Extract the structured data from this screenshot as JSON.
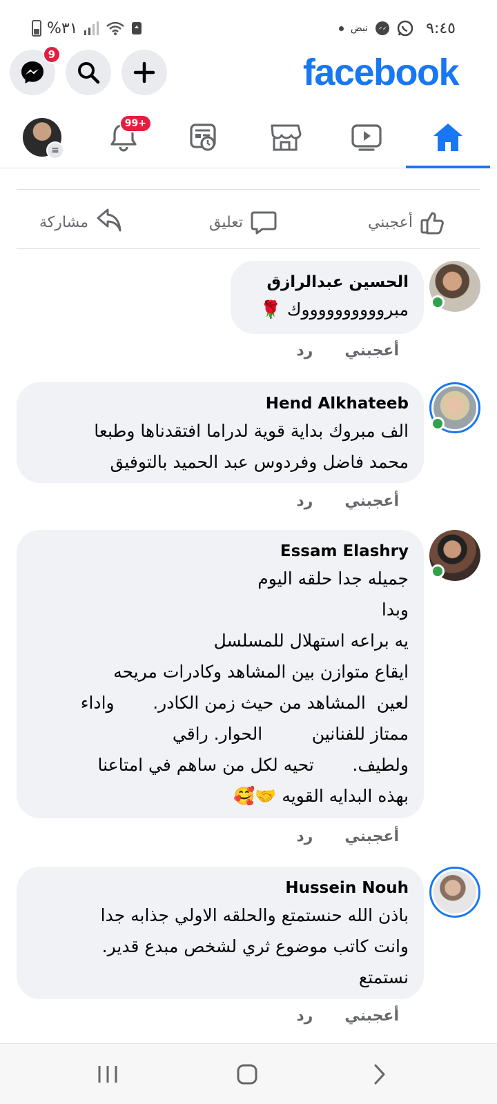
{
  "status_bar": {
    "time": "٩:٤٥",
    "pulse_label": "نبض",
    "battery": "%٣١"
  },
  "header": {
    "logo": "facebook",
    "messenger_badge": "9",
    "accent_color": "#1877f2"
  },
  "tabs": [
    {
      "name": "home",
      "icon": "home-icon",
      "active": true
    },
    {
      "name": "watch",
      "icon": "video-icon"
    },
    {
      "name": "marketplace",
      "icon": "store-icon"
    },
    {
      "name": "memories",
      "icon": "news-clock-icon"
    },
    {
      "name": "notifications",
      "icon": "bell-icon",
      "badge": "99+"
    },
    {
      "name": "menu",
      "icon": "profile-menu-icon"
    }
  ],
  "post_actions": {
    "like": "أعجبني",
    "comment": "تعليق",
    "share": "مشاركة"
  },
  "comments": [
    {
      "author": "الحسين عبدالرازق",
      "text": "مبرووووووووووك 🌹",
      "like_label": "أعجبني",
      "reply_label": "رد"
    },
    {
      "author": "Hend Alkhateeb",
      "text": "الف مبروك بداية قوية لدراما افتقدناها وطبعا\nمحمد فاضل وفردوس عبد الحميد بالتوفيق",
      "like_label": "أعجبني",
      "reply_label": "رد"
    },
    {
      "author": "Essam Elashry",
      "text": "جميله جدا حلقه اليوم\nوبدا\nيه براعه استهلال للمسلسل\nايقاع متوازن بين المشاهد وكادرات مريحه\nلعين  المشاهد من حيث زمن الكادر.       واداء\nممتاز للفنانين         الحوار. راقي\nولطيف.       تحيه لكل من ساهم في امتاعنا\nبهذه البدايه القويه 🤝🥰",
      "like_label": "أعجبني",
      "reply_label": "رد"
    },
    {
      "author": "Hussein Nouh",
      "text": "باذن الله حنستمتع والحلقه الاولي جذابه جدا\nوانت كاتب موضوع ثري لشخص مبدع قدير.\nنستمتع",
      "like_label": "أعجبني",
      "reply_label": "رد"
    }
  ]
}
